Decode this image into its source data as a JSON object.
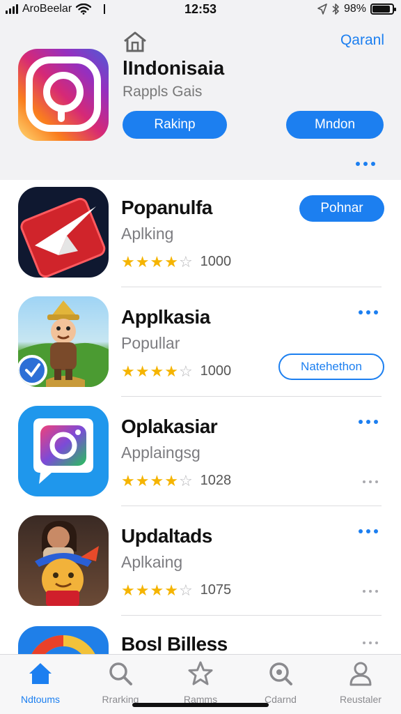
{
  "status_bar": {
    "carrier": "AroBeelar",
    "time": "12:53",
    "battery_text": "98%",
    "battery_level": 0.9,
    "icons": [
      "signal-icon",
      "wifi-icon",
      "location-icon",
      "bluetooth-icon",
      "battery-icon"
    ]
  },
  "header": {
    "top_link": "Qaranl",
    "title": "lIndonisaia",
    "subtitle": "Rappls Gais",
    "primary_button": "Rakinp",
    "secondary_button": "Mndon",
    "more_icon": "ellipsis-icon"
  },
  "apps": [
    {
      "title": "Popanulfa",
      "subtitle": "Aplking",
      "rating": 4,
      "count": "1000",
      "action_label": "Pohnar"
    },
    {
      "title": "Applkasia",
      "subtitle": "Popullar",
      "rating": 4,
      "count": "1000",
      "action_label": "Natehethon"
    },
    {
      "title": "Oplakasiar",
      "subtitle": "Applaingsg",
      "rating": 4,
      "count": "1028"
    },
    {
      "title": "Updaltads",
      "subtitle": "Aplkaing",
      "rating": 4,
      "count": "1075"
    },
    {
      "title": "Bosl Billess"
    }
  ],
  "tabs": [
    {
      "label": "Ndtoums",
      "icon": "home-icon",
      "active": true
    },
    {
      "label": "Rrarking",
      "icon": "search-icon"
    },
    {
      "label": "Ramms",
      "icon": "star-icon"
    },
    {
      "label": "Cdarnd",
      "icon": "magnifier-icon"
    },
    {
      "label": "Reustaler",
      "icon": "person-icon"
    }
  ],
  "colors": {
    "accent": "#1c7ff0",
    "star": "#f5b400",
    "background": "#f2f2f4"
  }
}
